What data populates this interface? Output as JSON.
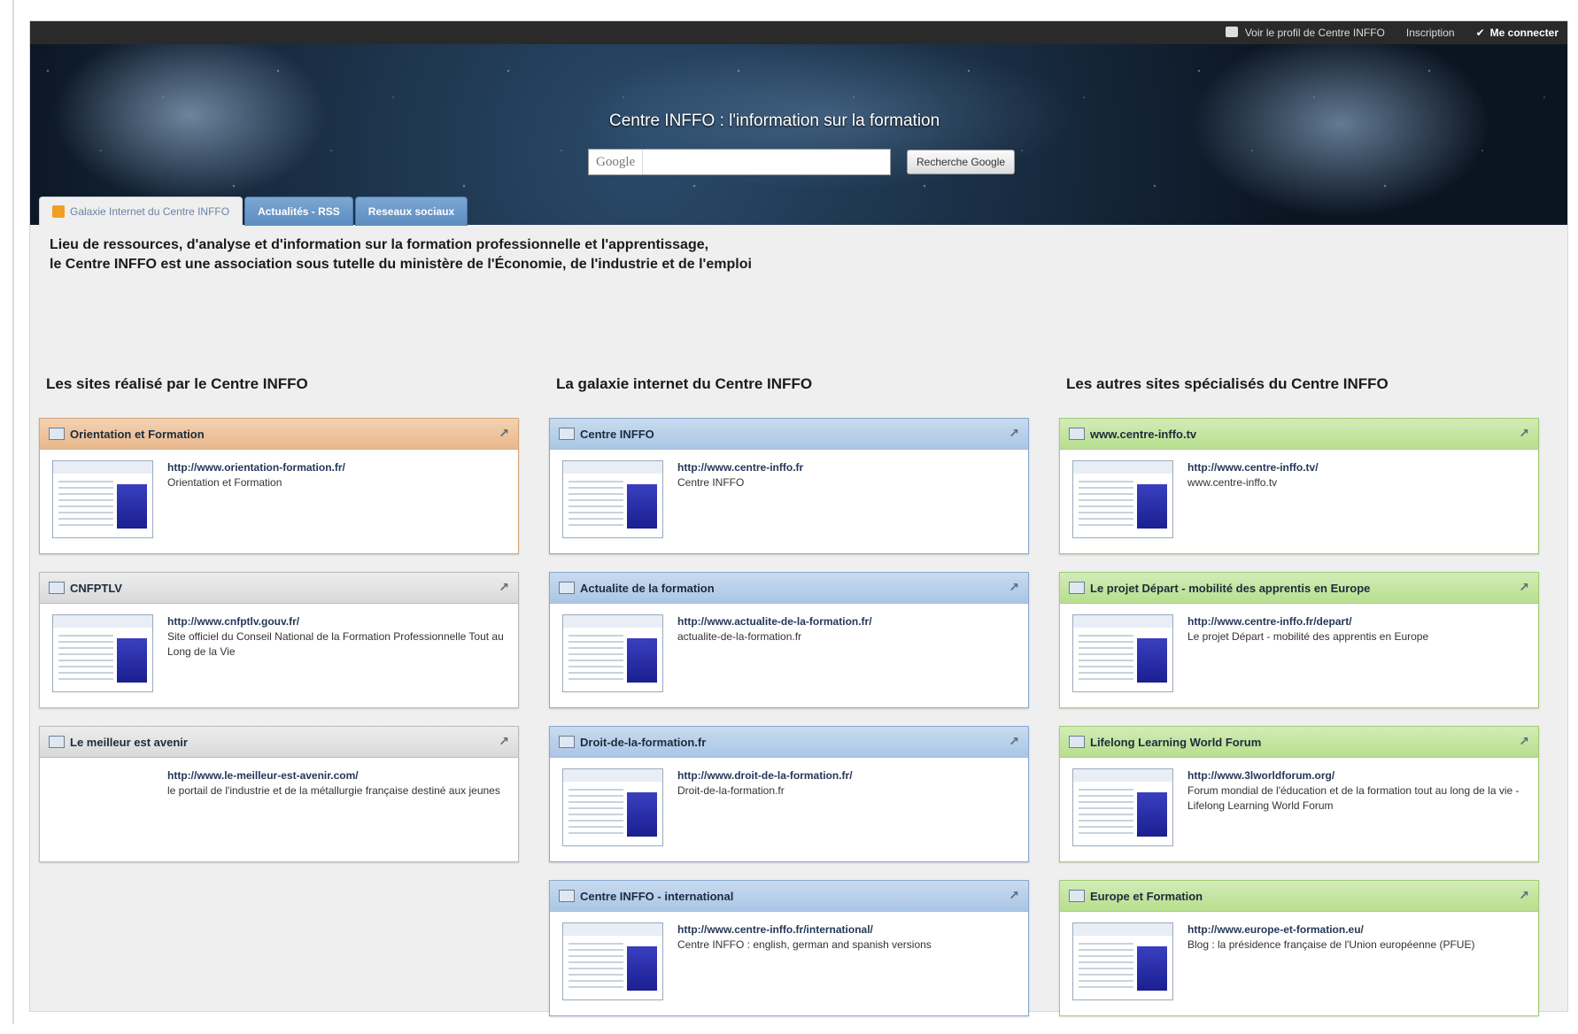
{
  "topbar": {
    "profile_link": "Voir le profil de Centre INFFO",
    "signup_link": "Inscription",
    "login_link": "Me connecter"
  },
  "header": {
    "title": "Centre INFFO : l'information sur la formation",
    "search_logo": "Google",
    "search_button": "Recherche Google"
  },
  "tabs": [
    {
      "label": "Galaxie Internet du Centre INFFO"
    },
    {
      "label": "Actualités - RSS"
    },
    {
      "label": "Reseaux sociaux"
    }
  ],
  "intro": {
    "line1": "Lieu de ressources, d'analyse et d'information sur la formation professionnelle et l'apprentissage,",
    "line2": "le Centre INFFO est une association sous tutelle du ministère de l'Économie, de l'industrie et de l'emploi"
  },
  "columns": [
    {
      "title": "Les sites réalisé par le Centre INFFO",
      "cards": [
        {
          "title": "Orientation et Formation",
          "url": "http://www.orientation-formation.fr/",
          "desc": "Orientation et Formation"
        },
        {
          "title": "CNFPTLV",
          "url": "http://www.cnfptlv.gouv.fr/",
          "desc": "Site officiel du Conseil National de la Formation Professionnelle Tout au Long de la Vie"
        },
        {
          "title": "Le meilleur est avenir",
          "url": "http://www.le-meilleur-est-avenir.com/",
          "desc": "le portail de l'industrie et de la métallurgie française destiné aux jeunes"
        }
      ]
    },
    {
      "title": "La galaxie internet du Centre INFFO",
      "cards": [
        {
          "title": "Centre INFFO",
          "url": "http://www.centre-inffo.fr",
          "desc": "Centre INFFO"
        },
        {
          "title": "Actualite de la formation",
          "url": "http://www.actualite-de-la-formation.fr/",
          "desc": "actualite-de-la-formation.fr"
        },
        {
          "title": "Droit-de-la-formation.fr",
          "url": "http://www.droit-de-la-formation.fr/",
          "desc": "Droit-de-la-formation.fr"
        },
        {
          "title": "Centre INFFO - international",
          "url": "http://www.centre-inffo.fr/international/",
          "desc": "Centre INFFO : english, german and spanish versions"
        }
      ]
    },
    {
      "title": "Les autres sites spécialisés du Centre INFFO",
      "cards": [
        {
          "title": "www.centre-inffo.tv",
          "url": "http://www.centre-inffo.tv/",
          "desc": "www.centre-inffo.tv"
        },
        {
          "title": "Le projet Départ - mobilité des apprentis en Europe",
          "url": "http://www.centre-inffo.fr/depart/",
          "desc": "Le projet Départ - mobilité des apprentis en Europe"
        },
        {
          "title": "Lifelong Learning World Forum",
          "url": "http://www.3lworldforum.org/",
          "desc": "Forum mondial de l'éducation et de la formation tout au long de la vie - Lifelong Learning World Forum"
        },
        {
          "title": "Europe et Formation",
          "url": "http://www.europe-et-formation.eu/",
          "desc": "Blog : la présidence française de l'Union européenne (PFUE)"
        }
      ]
    }
  ]
}
